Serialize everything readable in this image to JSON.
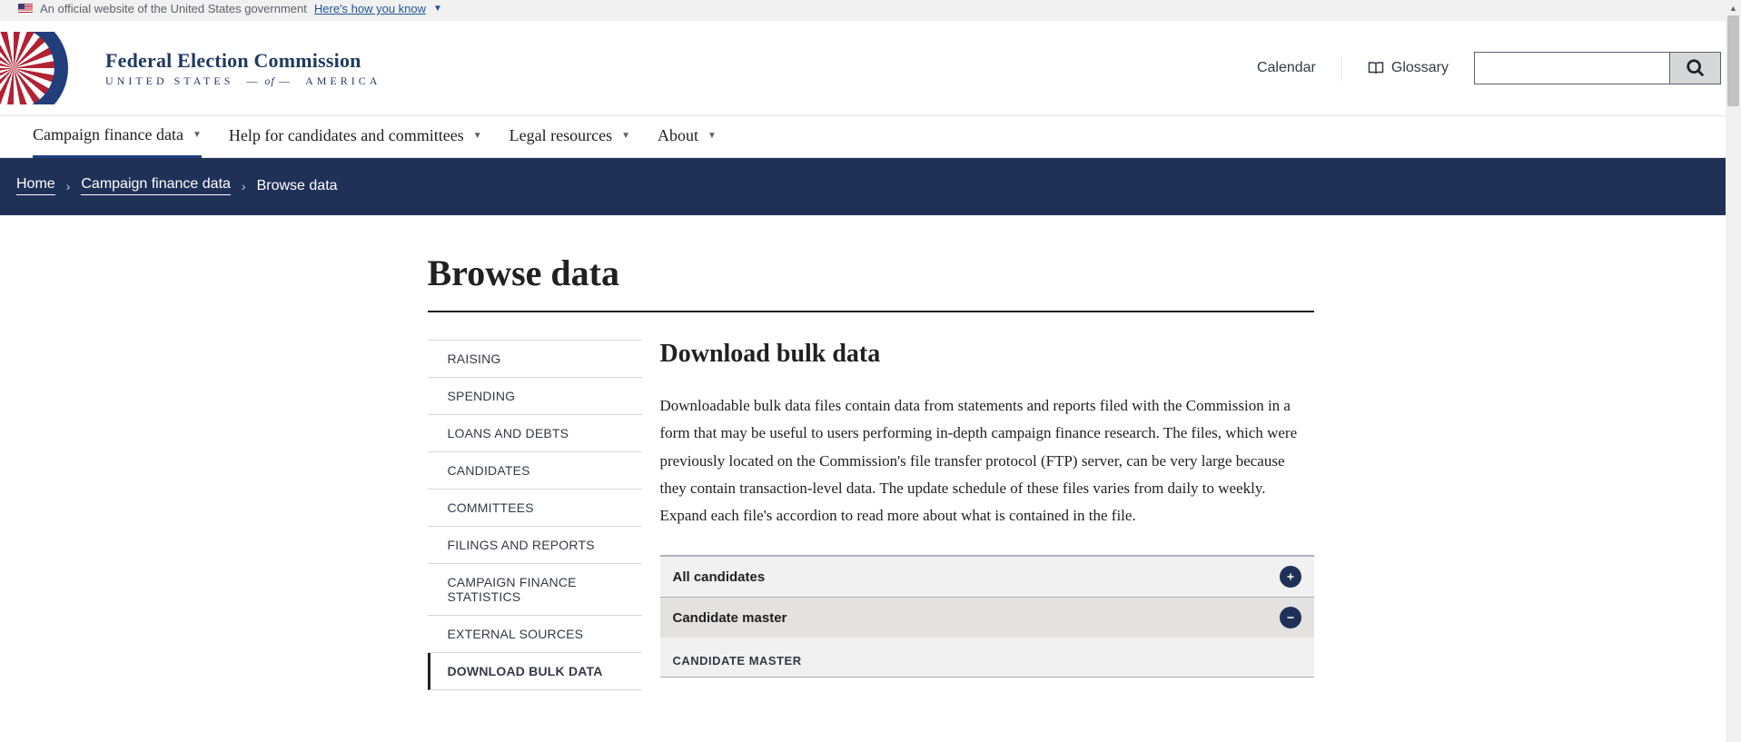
{
  "gov_banner": {
    "text": "An official website of the United States government",
    "link": "Here's how you know"
  },
  "brand": {
    "title": "Federal Election Commission",
    "sub_prefix": "UNITED STATES",
    "sub_of": "of",
    "sub_suffix": "AMERICA"
  },
  "header_links": {
    "calendar": "Calendar",
    "glossary": "Glossary"
  },
  "search": {
    "placeholder": ""
  },
  "main_nav": [
    {
      "label": "Campaign finance data",
      "active": true
    },
    {
      "label": "Help for candidates and committees",
      "active": false
    },
    {
      "label": "Legal resources",
      "active": false
    },
    {
      "label": "About",
      "active": false
    }
  ],
  "breadcrumb": {
    "home": "Home",
    "parent": "Campaign finance data",
    "current": "Browse data"
  },
  "page_title": "Browse data",
  "sidebar": {
    "items": [
      {
        "label": "RAISING",
        "active": false
      },
      {
        "label": "SPENDING",
        "active": false
      },
      {
        "label": "LOANS AND DEBTS",
        "active": false
      },
      {
        "label": "CANDIDATES",
        "active": false
      },
      {
        "label": "COMMITTEES",
        "active": false
      },
      {
        "label": "FILINGS AND REPORTS",
        "active": false
      },
      {
        "label": "CAMPAIGN FINANCE STATISTICS",
        "active": false
      },
      {
        "label": "EXTERNAL SOURCES",
        "active": false
      },
      {
        "label": "DOWNLOAD BULK DATA",
        "active": true
      }
    ]
  },
  "section": {
    "heading": "Download bulk data",
    "body": "Downloadable bulk data files contain data from statements and reports filed with the Commission in a form that may be useful to users performing in-depth campaign finance research. The files, which were previously located on the Commission's file transfer protocol (FTP) server, can be very large because they contain transaction-level data. The update schedule of these files varies from daily to weekly. Expand each file's accordion to read more about what is contained in the file."
  },
  "accordion": [
    {
      "title": "All candidates",
      "expanded": false
    },
    {
      "title": "Candidate master",
      "expanded": true,
      "body_heading": "CANDIDATE MASTER"
    }
  ]
}
